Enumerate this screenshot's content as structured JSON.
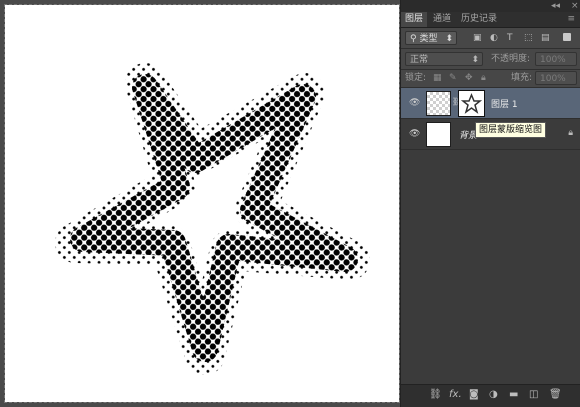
{
  "panel_tabs": [
    "图层",
    "通道",
    "历史记录"
  ],
  "panel_top": {
    "collapse": "◂◂",
    "close": "×",
    "menu": "≡"
  },
  "filter": {
    "label": "类型"
  },
  "blend": {
    "mode": "正常",
    "opacity_label": "不透明度:",
    "opacity_value": "100%"
  },
  "lock": {
    "label": "锁定:",
    "fill_label": "填充:",
    "fill_value": "100%"
  },
  "layers": [
    {
      "name": "图层 1"
    },
    {
      "name": "背景"
    }
  ],
  "tooltip": "图层蒙版缩览图",
  "bottom_icons": [
    "link-layers-icon",
    "fx-icon",
    "mask-icon",
    "adjustment-icon",
    "folder-icon",
    "new-layer-icon",
    "trash-icon"
  ],
  "bottom_fx": "fx."
}
